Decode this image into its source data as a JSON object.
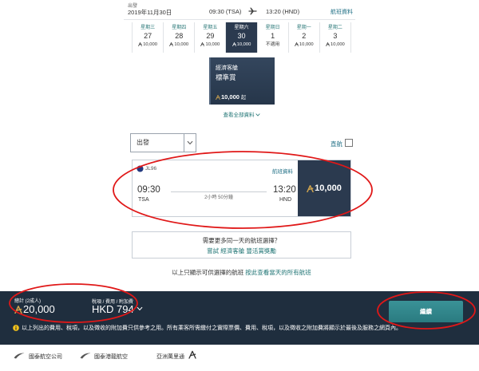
{
  "header": {
    "depart_label": "出發",
    "date": "2019年11月30日",
    "depart_time": "09:30 (TSA)",
    "arrive_time": "13:20 (HND)",
    "flight_info_link": "航班資料"
  },
  "date_tiles": [
    {
      "weekday": "星期三",
      "day": "27",
      "price": "10,000",
      "selected": false
    },
    {
      "weekday": "星期四",
      "day": "28",
      "price": "10,000",
      "selected": false
    },
    {
      "weekday": "星期五",
      "day": "29",
      "price": "10,000",
      "selected": false
    },
    {
      "weekday": "星期六",
      "day": "30",
      "price": "10,000",
      "selected": true
    },
    {
      "weekday": "星期日",
      "day": "1",
      "price": "不適用",
      "selected": false
    },
    {
      "weekday": "星期一",
      "day": "2",
      "price": "10,000",
      "selected": false
    },
    {
      "weekday": "星期二",
      "day": "3",
      "price": "10,000",
      "selected": false
    }
  ],
  "fare_card": {
    "cabin": "經濟客艙",
    "type": "標準賞",
    "price": "10,000",
    "suffix": "起"
  },
  "view_all_link": "查看全部資料",
  "filter": {
    "sort_select": "出發",
    "nonstop_label": "直航",
    "nonstop_checked": false
  },
  "flight": {
    "code": "JL96",
    "info_link": "航班資料",
    "depart_time": "09:30",
    "depart_airport": "TSA",
    "duration": "2小時 50分鐘",
    "arrive_time": "13:20",
    "arrive_airport": "HND",
    "price": "10,000"
  },
  "more_options": {
    "question": "需要更多同一天的航班選擇？",
    "link": "嘗試 經濟客艙 豐活賞獎勵"
  },
  "availability_note": {
    "text": "以上只顯示可供選擇的航班 ",
    "link": "按此查看當天的所有航班"
  },
  "summary_bar": {
    "total_label": "總計 (2成人)",
    "total_value": "20,000",
    "tax_label": "稅項 / 費用 / 附加費",
    "tax_value": "HKD 794",
    "continue_button": "繼續",
    "disclaimer": "以上列出的費用、稅項，以及徵收的附加費只供參考之用。所有乘客所需繳付之實際票價、費用、稅項，以及徵收之附加費將顯示於最後及服務之網頁內。"
  },
  "footer": {
    "cathay_pacific": "國泰航空公司",
    "cathay_dragon": "國泰港龍航空",
    "asia_miles": "亞洲萬里通"
  },
  "colors": {
    "navy": "#2b3a4f",
    "bar": "#1f2e3e",
    "teal_link": "#1f7474",
    "button": "#2e8287",
    "miles_gold": "#d1a54f",
    "info_yellow": "#f2c21b",
    "annotation": "#e01818"
  }
}
